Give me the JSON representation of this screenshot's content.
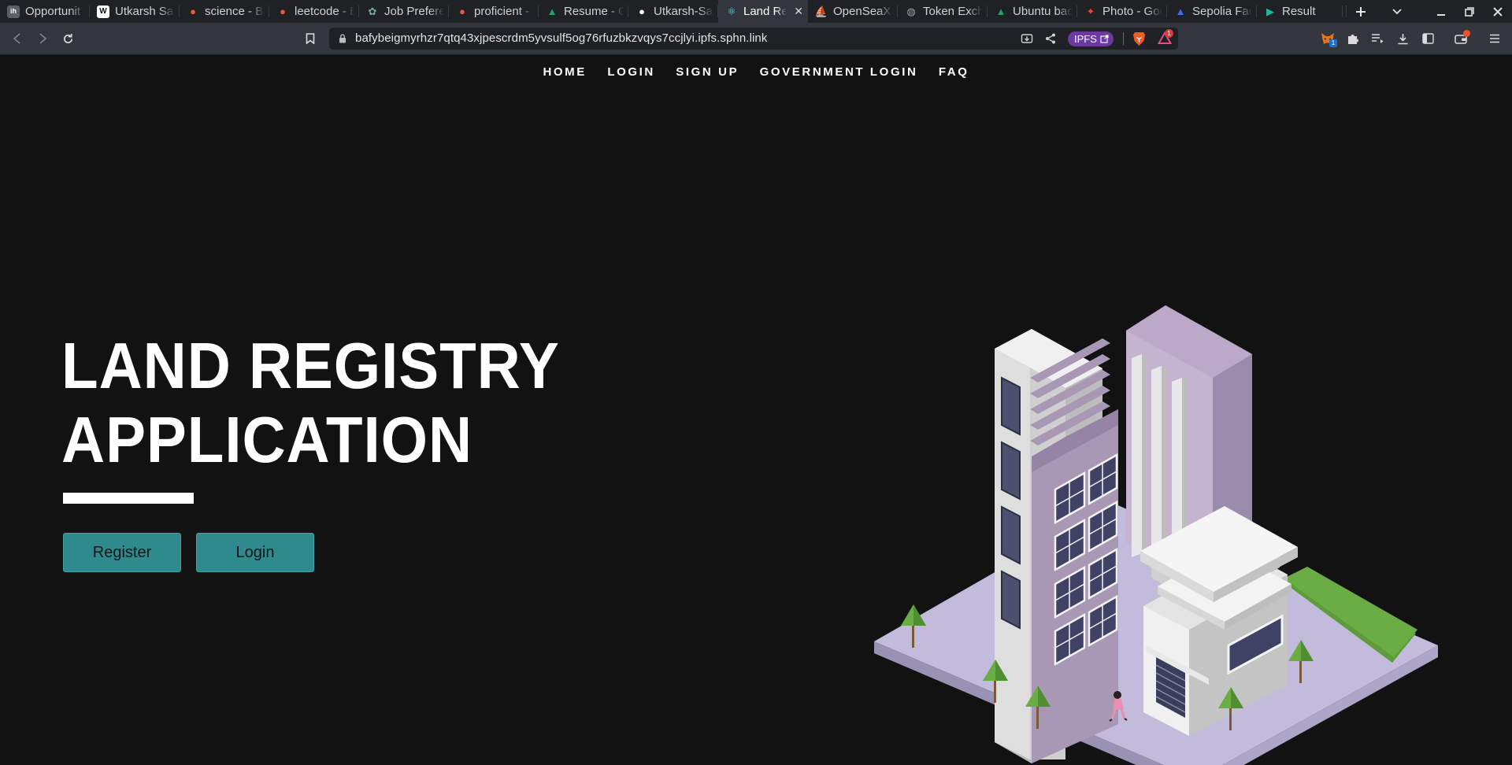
{
  "browser": {
    "tabs": [
      {
        "title": "Opportunit",
        "favicon": "ih",
        "favicon_color": "#5a5f6a",
        "active": false
      },
      {
        "title": "Utkarsh Sa",
        "favicon": "W",
        "favicon_color": "#ffffff",
        "active": false
      },
      {
        "title": "science - Br",
        "favicon": "brave-search",
        "favicon_color": "#f0573a",
        "active": false
      },
      {
        "title": "leetcode - E",
        "favicon": "brave-search",
        "favicon_color": "#f0573a",
        "active": false
      },
      {
        "title": "Job Prefere",
        "favicon": "chatgpt",
        "favicon_color": "#75a99c",
        "active": false
      },
      {
        "title": "proficient -",
        "favicon": "brave-search",
        "favicon_color": "#f0573a",
        "active": false
      },
      {
        "title": "Resume - G",
        "favicon": "google-drive",
        "favicon_color": "#1fa463",
        "active": false
      },
      {
        "title": "Utkarsh-Sa",
        "favicon": "github",
        "favicon_color": "#ffffff",
        "active": false
      },
      {
        "title": "Land Re",
        "favicon": "react",
        "favicon_color": "#61dafb",
        "active": true
      },
      {
        "title": "OpenSeaX",
        "favicon": "opensea",
        "favicon_color": "#2081e2",
        "active": false
      },
      {
        "title": "Token Exch",
        "favicon": "globe",
        "favicon_color": "#9aa0a6",
        "active": false
      },
      {
        "title": "Ubuntu bac",
        "favicon": "google-drive",
        "favicon_color": "#1fa463",
        "active": false
      },
      {
        "title": "Photo - Goo",
        "favicon": "google-photos",
        "favicon_color": "#ea4335",
        "active": false
      },
      {
        "title": "Sepolia Fau",
        "favicon": "alchemy",
        "favicon_color": "#3b6ef5",
        "active": false
      },
      {
        "title": "Result",
        "favicon": "play",
        "favicon_color": "#1db8a0",
        "active": false
      }
    ],
    "url": "bafybeigmyrhzr7qtq43xjpescrdm5yvsulf5og76rfuzbkzvqys7ccjlyi.ipfs.sphn.link",
    "ipfs_label": "IPFS",
    "brave_rewards_badge": "1",
    "metamask_badge": "1"
  },
  "nav": {
    "items": [
      "HOME",
      "LOGIN",
      "SIGN UP",
      "GOVERNMENT LOGIN",
      "FAQ"
    ]
  },
  "hero": {
    "title_line1": "LAND REGISTRY",
    "title_line2": "APPLICATION",
    "register_label": "Register",
    "login_label": "Login"
  },
  "colors": {
    "page_bg": "#121212",
    "button_bg": "#2e8a8c",
    "building_purple": "#a897b5",
    "ground": "#c3bbdc",
    "grass": "#6aad44"
  }
}
